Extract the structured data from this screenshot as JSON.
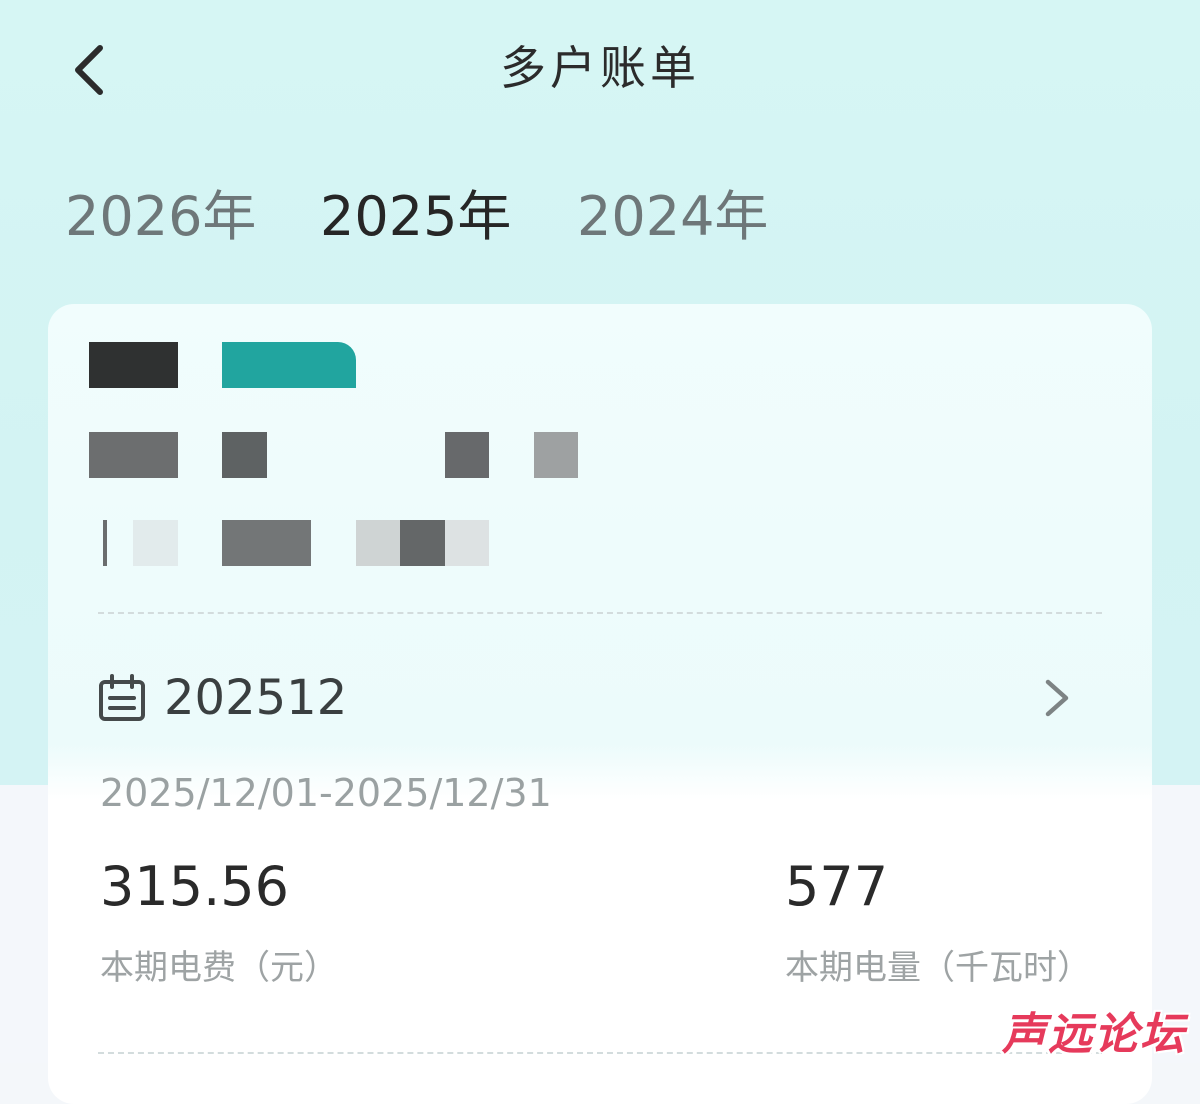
{
  "header": {
    "title": "多户账单"
  },
  "year_tabs": [
    {
      "label": "2026年",
      "selected": false
    },
    {
      "label": "2025年",
      "selected": true
    },
    {
      "label": "2024年",
      "selected": false
    }
  ],
  "bill": {
    "period": "202512",
    "date_range": "2025/12/01-2025/12/31",
    "fee": {
      "value": "315.56",
      "label": "本期电费（元）"
    },
    "usage": {
      "value": "577",
      "label": "本期电量（千瓦时）"
    }
  },
  "watermark": "声远论坛",
  "colors": {
    "accent": "#1fa6a0",
    "background_top": "#d4f4f3",
    "watermark": "#e63a5b"
  },
  "icons": {
    "back": "chevron-left-icon",
    "calendar": "calendar-icon",
    "forward": "chevron-right-icon"
  }
}
